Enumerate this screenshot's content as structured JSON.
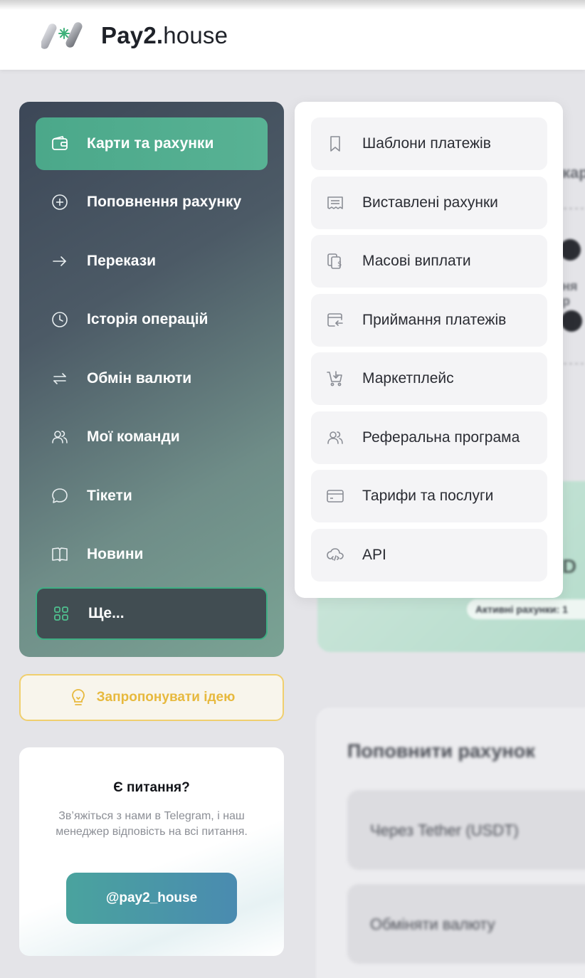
{
  "header": {
    "brand_bold": "Pay2.",
    "brand_light": "house"
  },
  "nav": {
    "items": [
      {
        "label": "Карти та рахунки",
        "icon": "wallet-icon"
      },
      {
        "label": "Поповнення рахунку",
        "icon": "plus-circle-icon"
      },
      {
        "label": "Перекази",
        "icon": "arrow-right-icon"
      },
      {
        "label": "Історія операцій",
        "icon": "clock-icon"
      },
      {
        "label": "Обмін валюти",
        "icon": "exchange-icon"
      },
      {
        "label": "Мої команди",
        "icon": "users-icon"
      },
      {
        "label": "Тікети",
        "icon": "chat-icon"
      },
      {
        "label": "Новини",
        "icon": "book-icon"
      }
    ],
    "more_label": "Ще..."
  },
  "idea_button": {
    "label": "Запропонувати ідею",
    "icon": "lightbulb-icon"
  },
  "support": {
    "title": "Є питання?",
    "text": "Зв’яжіться з нами в Telegram, і наш менеджер відповість на всі питання.",
    "button_label": "@pay2_house"
  },
  "dropdown": {
    "items": [
      {
        "label": "Шаблони платежів",
        "icon": "bookmark-icon"
      },
      {
        "label": "Виставлені рахунки",
        "icon": "invoice-icon"
      },
      {
        "label": "Масові виплати",
        "icon": "mass-payout-icon"
      },
      {
        "label": "Приймання платежів",
        "icon": "card-receive-icon"
      },
      {
        "label": "Маркетплейс",
        "icon": "cart-icon"
      },
      {
        "label": "Реферальна програма",
        "icon": "users-icon"
      },
      {
        "label": "Тарифи та послуги",
        "icon": "card-icon"
      },
      {
        "label": "API",
        "icon": "cloud-code-icon"
      }
    ]
  },
  "background": {
    "chip_text": "Активні рахунки: 1",
    "big_letter": "D",
    "panel_title": "Поповнити рахунок",
    "rows": [
      "Через Tether (USDT)",
      "Обміняти валюту"
    ],
    "fragments": [
      "кар",
      "ня р"
    ]
  },
  "colors": {
    "accent_green": "#4ba88a",
    "idea_yellow": "#e7b93e",
    "telegram_gradient_start": "#4aa39e",
    "telegram_gradient_end": "#4a8bb0"
  }
}
